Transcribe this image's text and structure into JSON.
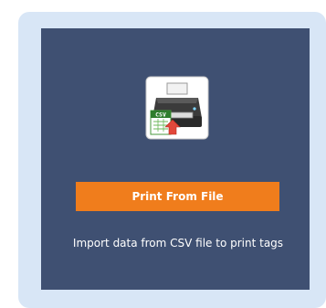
{
  "tile": {
    "icon": "printer-csv-icon",
    "icon_badge": "CSV",
    "button_label": "Print From File",
    "description": "Import data from CSV file to print tags"
  },
  "colors": {
    "outer_frame": "#d8e6f6",
    "tile_background": "#3f5072",
    "button": "#f07d1c",
    "text": "#ffffff"
  }
}
